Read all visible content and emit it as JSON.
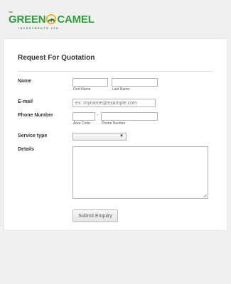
{
  "brand": {
    "top_text": "THE",
    "name_part1": "GREEN",
    "name_part2": "CAMEL",
    "tagline": "INVESTMENTS LTD",
    "color": "#2e9e3a",
    "accent": "#f2a900"
  },
  "form": {
    "title": "Request For Quotation",
    "name": {
      "label": "Name",
      "first_sublabel": "First Name",
      "last_sublabel": "Last Name",
      "first_value": "",
      "last_value": ""
    },
    "email": {
      "label": "E-mail",
      "placeholder": "ex: myname@example.com",
      "value": ""
    },
    "phone": {
      "label": "Phone Number",
      "area_sublabel": "Area Code",
      "number_sublabel": "Phone Number",
      "separator": "-",
      "area_value": "",
      "number_value": ""
    },
    "service": {
      "label": "Service type",
      "selected": "",
      "arrow": "▼"
    },
    "details": {
      "label": "Details",
      "value": ""
    },
    "submit_label": "Submit Enquiry"
  }
}
